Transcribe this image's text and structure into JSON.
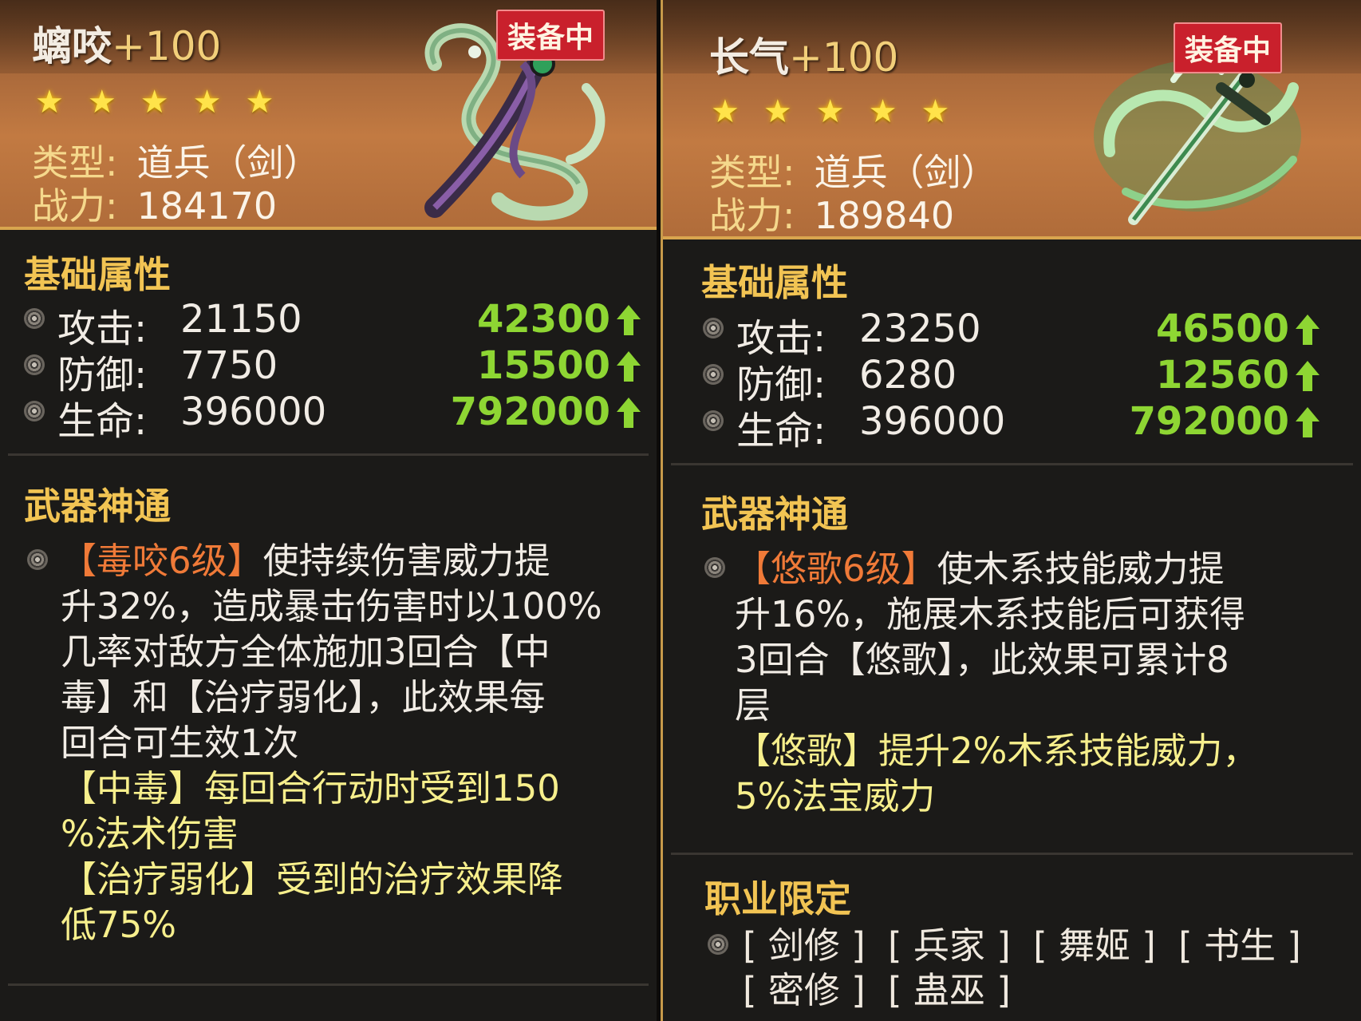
{
  "left_card": {
    "name": "螭咬",
    "level": "+100",
    "equip_badge": "装备中",
    "stars": 5,
    "type_label": "类型:",
    "type_value": "道兵（剑）",
    "power_label": "战力:",
    "power_value": "184170",
    "base_title": "基础属性",
    "stats": [
      {
        "label": "攻击:",
        "value": "21150",
        "max": "42300"
      },
      {
        "label": "防御:",
        "value": "7750",
        "max": "15500"
      },
      {
        "label": "生命:",
        "value": "396000",
        "max": "792000"
      }
    ],
    "skill_title": "武器神通",
    "skill_name": "【毒咬6级】",
    "skill_line1": "使持续伤害威力提",
    "skill_line2": "升32%，造成暴击伤害时以100%",
    "skill_line3": "几率对敌方全体施加3回合【中",
    "skill_line4": "毒】和【治疗弱化】，此效果每",
    "skill_line5": "回合可生效1次",
    "extra_line1": "【中毒】每回合行动时受到150",
    "extra_line2": "%法术伤害",
    "extra_line3": "【治疗弱化】受到的治疗效果降",
    "extra_line4": "低75%"
  },
  "right_card": {
    "name": "长气",
    "level": "+100",
    "equip_badge": "装备中",
    "stars": 5,
    "type_label": "类型:",
    "type_value": "道兵（剑）",
    "power_label": "战力:",
    "power_value": "189840",
    "base_title": "基础属性",
    "stats": [
      {
        "label": "攻击:",
        "value": "23250",
        "max": "46500"
      },
      {
        "label": "防御:",
        "value": "6280",
        "max": "12560"
      },
      {
        "label": "生命:",
        "value": "396000",
        "max": "792000"
      }
    ],
    "skill_title": "武器神通",
    "skill_name": "【悠歌6级】",
    "skill_line1": "使木系技能威力提",
    "skill_line2": "升16%，施展木系技能后可获得",
    "skill_line3": "3回合【悠歌】，此效果可累计8",
    "skill_line4": "层",
    "extra_line1": "【悠歌】提升2%木系技能威力，",
    "extra_line2": "5%法宝威力",
    "job_title": "职业限定",
    "jobs_row1": [
      "[ 剑修 ]",
      "[ 兵家 ]",
      "[ 舞姬 ]",
      "[ 书生 ]"
    ],
    "jobs_row2": [
      "[ 密修 ]",
      "[ 蛊巫 ]"
    ]
  },
  "colors": {
    "accent_gold": "#f2c453",
    "stat_green": "#8ed633",
    "skill_orange": "#f07a38",
    "effect_yellow": "#f7ef8c",
    "badge_red": "#c9202c"
  },
  "icons": [
    "star-icon",
    "bullet-icon",
    "arrow-up-icon",
    "weapon-icon"
  ]
}
